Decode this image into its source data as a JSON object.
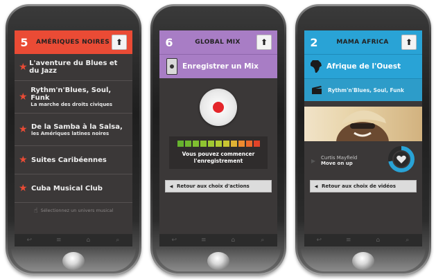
{
  "colors": {
    "red": "#ea4b35",
    "purple": "#a87dc5",
    "blue": "#29a3d6"
  },
  "phone1": {
    "header": {
      "number": "5",
      "title": "AMÉRIQUES NOIRES"
    },
    "items": [
      {
        "label": "L'aventure du Blues et du Jazz",
        "sub": ""
      },
      {
        "label": "Rythm'n'Blues, Soul, Funk",
        "sub": "La marche des droits civiques"
      },
      {
        "label": "De la Samba à la Salsa,",
        "sub": "les Amériques latines noires"
      },
      {
        "label": "Suites Caribéennes",
        "sub": ""
      },
      {
        "label": "Cuba Musical Club",
        "sub": ""
      }
    ],
    "footer": "Sélectionnez un univers musical"
  },
  "phone2": {
    "header": {
      "number": "6",
      "title": "GLOBAL MIX"
    },
    "action": "Enregistrer un Mix",
    "meter_levels": [
      "#66b32e",
      "#71b82f",
      "#7fbe30",
      "#8fc431",
      "#9fc932",
      "#b2cc33",
      "#c9c532",
      "#e0b234",
      "#ee8a2f",
      "#ea6a2c",
      "#e24328"
    ],
    "status_line1": "Vous pouvez commencer",
    "status_line2": "l'enregistrement",
    "back": "Retour aux choix d'actions"
  },
  "phone3": {
    "header": {
      "number": "2",
      "title": "MAMA AFRICA"
    },
    "region": "Afrique de l'Ouest",
    "subcategory": "Rythm'n'Blues, Soul, Funk",
    "track": {
      "artist": "Curtis Mayfield",
      "song": "Move on up",
      "progress": 0.72
    },
    "back": "Retour aux choix de vidéos"
  }
}
